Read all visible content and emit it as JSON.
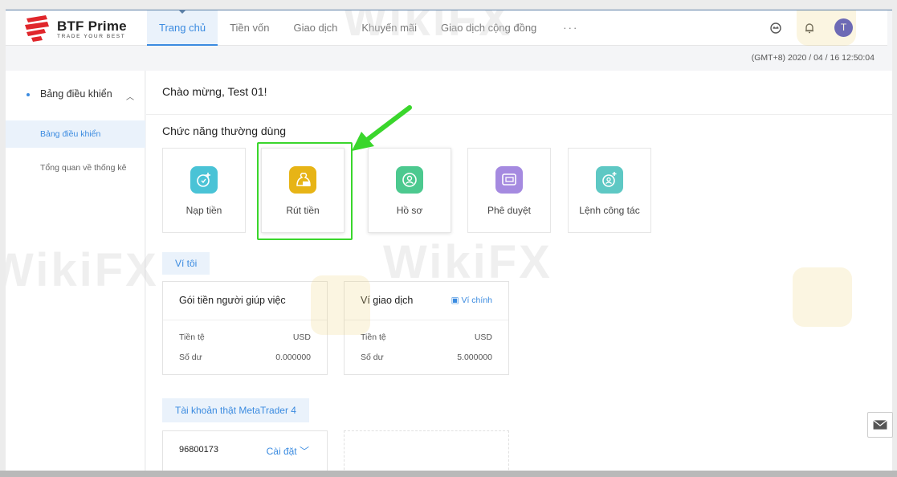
{
  "header": {
    "brand": "BTF Prime",
    "tagline": "TRADE YOUR BEST",
    "nav": [
      {
        "label": "Trang chủ",
        "active": true
      },
      {
        "label": "Tiền vốn"
      },
      {
        "label": "Giao dịch"
      },
      {
        "label": "Khuyến mãi"
      },
      {
        "label": "Giao dịch cộng đồng"
      },
      {
        "label": "···"
      }
    ],
    "avatar_initial": "T"
  },
  "timestamp": "(GMT+8) 2020 / 04 / 16 12:50:04",
  "sidebar": {
    "group_label": "Bảng điều khiển",
    "items": [
      {
        "label": "Bảng điều khiển",
        "active": true
      },
      {
        "label": "Tổng quan về thống kê"
      }
    ]
  },
  "main": {
    "welcome": "Chào mừng, Test 01!",
    "section_title": "Chức năng thường dùng",
    "tiles": [
      {
        "label": "Nạp tiền",
        "color": "#4ac3d6"
      },
      {
        "label": "Rút tiền",
        "color": "#e7b416"
      },
      {
        "label": "Hồ sơ",
        "color": "#4cc98f"
      },
      {
        "label": "Phê duyệt",
        "color": "#a58ae0"
      },
      {
        "label": "Lệnh công tác",
        "color": "#5ec8c4"
      }
    ],
    "wallet_tab": "Ví tôi",
    "wallets": [
      {
        "title": "Gói tiền người giúp việc",
        "currency_label": "Tiền tệ",
        "currency": "USD",
        "balance_label": "Số dư",
        "balance": "0.000000"
      },
      {
        "title": "Ví giao dịch",
        "link": "Ví chính",
        "currency_label": "Tiền tệ",
        "currency": "USD",
        "balance_label": "Số dư",
        "balance": "5.000000"
      }
    ],
    "mt4_tab": "Tài khoản thật MetaTrader 4",
    "mt4_account": {
      "number": "96800173",
      "settings_label": "Cài đặt"
    }
  },
  "watermark": "WikiFX",
  "colors": {
    "accent": "#3b8be0",
    "highlight": "#3ad62c"
  }
}
